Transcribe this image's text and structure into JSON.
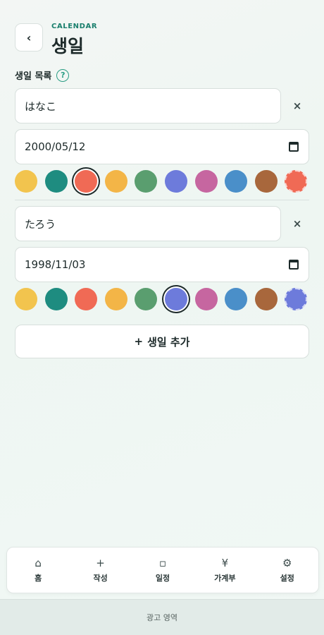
{
  "header": {
    "back_label": "‹",
    "eyebrow": "CALENDAR",
    "title": "생일"
  },
  "section": {
    "label": "생일 목록",
    "help": "?"
  },
  "palette": [
    "#f2c44e",
    "#1e8c80",
    "#f06a55",
    "#f3b547",
    "#5a9e6f",
    "#6d7bdb",
    "#c666a0",
    "#4a8fc9",
    "#a8673c"
  ],
  "entries": [
    {
      "name": "はなこ",
      "date": "2000/05/12",
      "selected_index": 2,
      "custom_color": "#f06a55",
      "remove": "×"
    },
    {
      "name": "たろう",
      "date": "1998/11/03",
      "selected_index": 5,
      "custom_color": "#6d7bdb",
      "remove": "×"
    }
  ],
  "add_button": {
    "icon": "+",
    "label": "생일 추가"
  },
  "nav": [
    {
      "icon": "⌂",
      "label": "홈"
    },
    {
      "icon": "+",
      "label": "작성"
    },
    {
      "icon": "▫",
      "label": "일정"
    },
    {
      "icon": "¥",
      "label": "가계부"
    },
    {
      "icon": "⚙",
      "label": "설정"
    }
  ],
  "ad": {
    "label": "광고 영역"
  }
}
